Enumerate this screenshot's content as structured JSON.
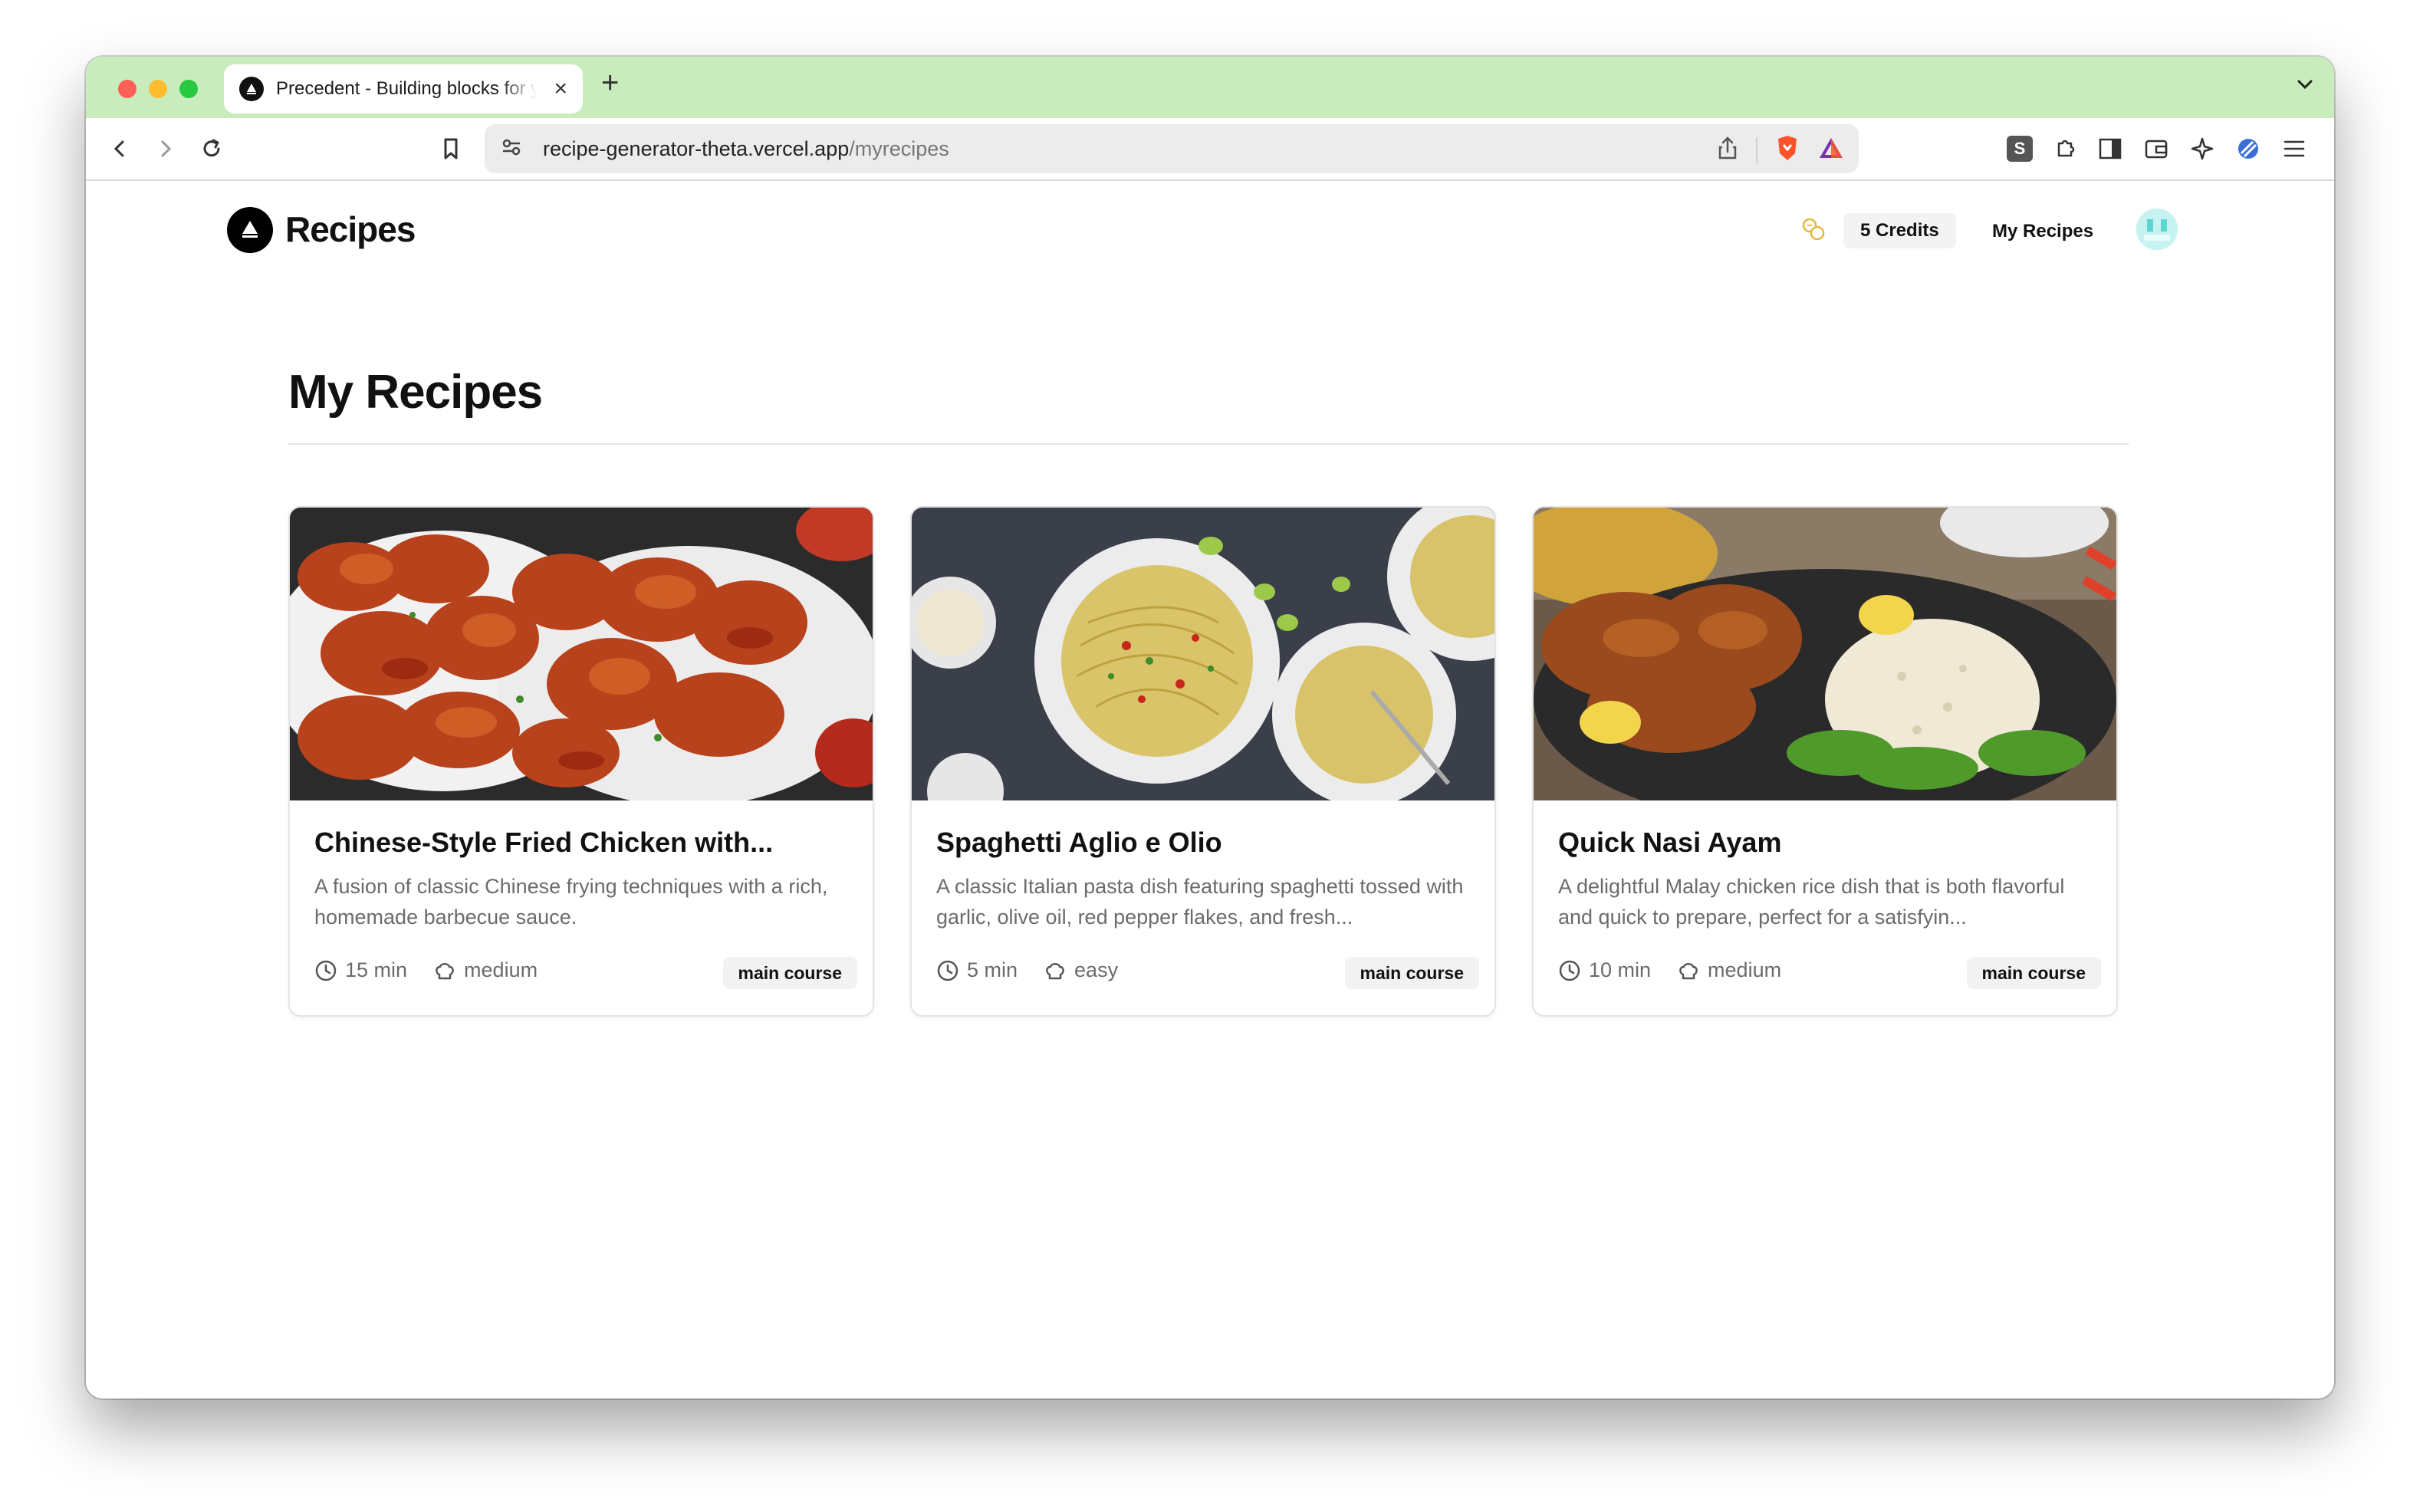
{
  "browser": {
    "tab_title": "Precedent - Building blocks for your Next project",
    "url_host": "recipe-generator-theta.vercel.app",
    "url_path": "/myrecipes"
  },
  "header": {
    "site_name": "Recipes",
    "credits_label": "5 Credits",
    "nav_link": "My Recipes"
  },
  "main": {
    "title": "My Recipes",
    "recipes": [
      {
        "title": "Chinese-Style Fried Chicken with...",
        "description": "A fusion of classic Chinese frying techniques with a rich, homemade barbecue sauce.",
        "time": "15 min",
        "difficulty": "medium",
        "category": "main course",
        "image_icon": "fried-chicken-image"
      },
      {
        "title": "Spaghetti Aglio e Olio",
        "description": "A classic Italian pasta dish featuring spaghetti tossed with garlic, olive oil, red pepper flakes, and fresh...",
        "time": "5 min",
        "difficulty": "easy",
        "category": "main course",
        "image_icon": "spaghetti-image"
      },
      {
        "title": "Quick Nasi Ayam",
        "description": "A delightful Malay chicken rice dish that is both flavorful and quick to prepare, perfect for a satisfyin...",
        "time": "10 min",
        "difficulty": "medium",
        "category": "main course",
        "image_icon": "chicken-rice-image"
      }
    ]
  },
  "colors": {
    "tab_bar": "#c9ecbd",
    "accent": "#111111",
    "muted_text": "#6b6b6b"
  }
}
